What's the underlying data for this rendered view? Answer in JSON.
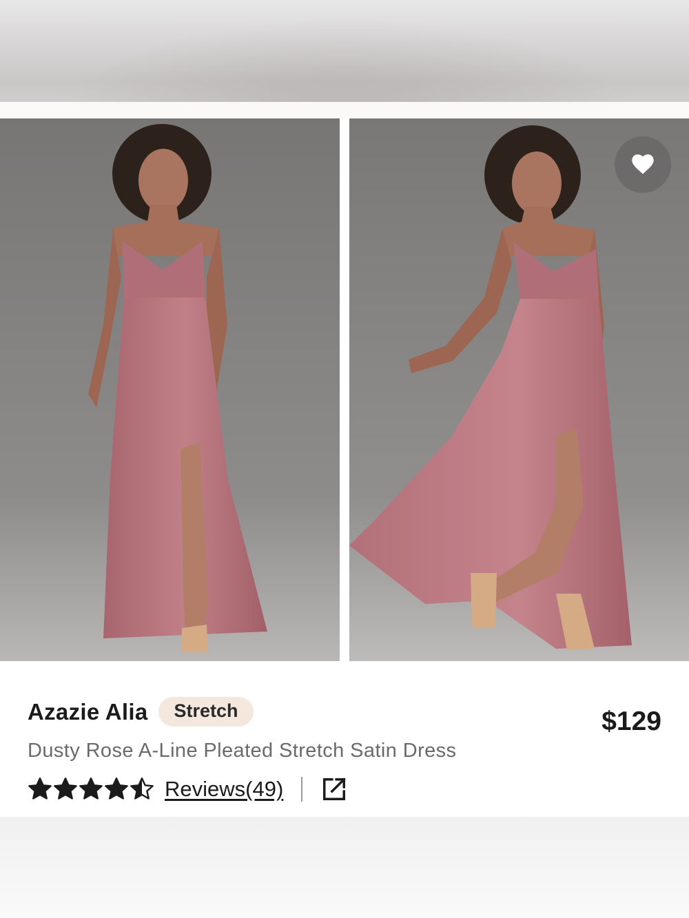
{
  "product": {
    "brand_name": "Azazie Alia",
    "tag": "Stretch",
    "description": "Dusty Rose A-Line Pleated Stretch Satin Dress",
    "price": "$129",
    "reviews_label": "Reviews(49)",
    "rating": 4.5,
    "rating_max": 5
  },
  "icons": {
    "favorite": "heart-icon",
    "external": "external-link-icon",
    "star": "star-icon"
  },
  "colors": {
    "dress": "#b7747c",
    "backdrop": "#7f7d7c",
    "badge_bg": "#f3e7de",
    "text_primary": "#1b1b1b",
    "text_secondary": "#6a6a6a"
  }
}
